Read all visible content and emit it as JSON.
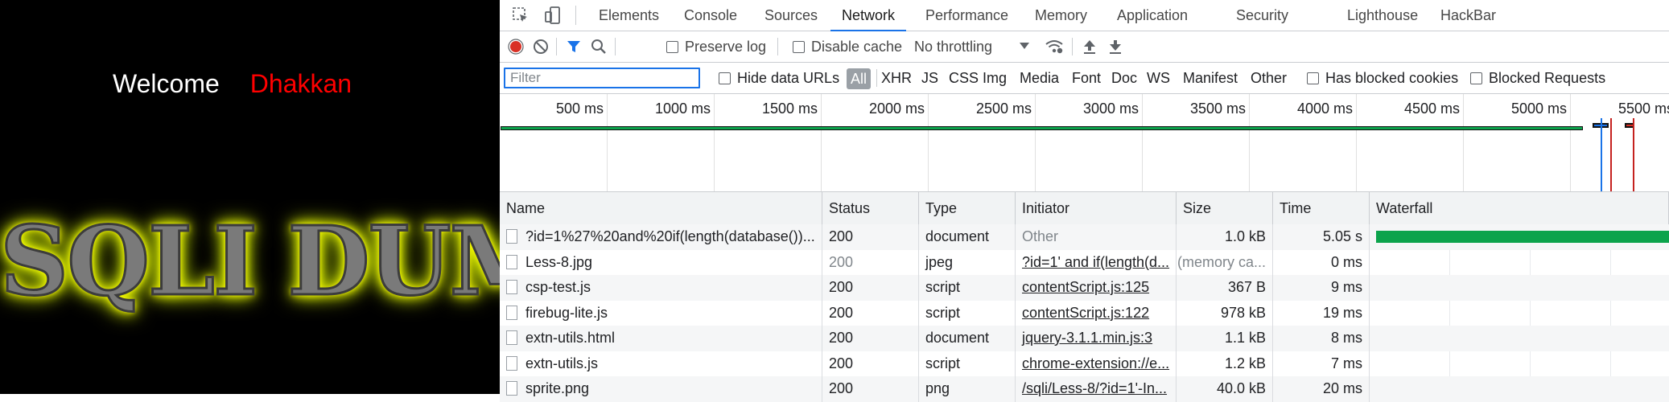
{
  "page": {
    "welcome_label": "Welcome",
    "user_name": "Dhakkan",
    "banner": "SQLI DUMB SERIES"
  },
  "devtools": {
    "tabs": [
      "Elements",
      "Console",
      "Sources",
      "Network",
      "Performance",
      "Memory",
      "Application",
      "Security",
      "Lighthouse",
      "HackBar"
    ],
    "active_tab": "Network",
    "toolbar": {
      "preserve_log": "Preserve log",
      "disable_cache": "Disable cache",
      "throttling": "No throttling"
    },
    "filterbar": {
      "filter_placeholder": "Filter",
      "hide_data_urls": "Hide data URLs",
      "types": [
        "All",
        "XHR",
        "JS",
        "CSS",
        "Img",
        "Media",
        "Font",
        "Doc",
        "WS",
        "Manifest",
        "Other"
      ],
      "has_blocked_cookies": "Has blocked cookies",
      "blocked_requests": "Blocked Requests"
    },
    "overview_ticks": [
      "500 ms",
      "1000 ms",
      "1500 ms",
      "2000 ms",
      "2500 ms",
      "3000 ms",
      "3500 ms",
      "4000 ms",
      "4500 ms",
      "5000 ms",
      "5500 ms"
    ],
    "columns": [
      "Name",
      "Status",
      "Type",
      "Initiator",
      "Size",
      "Time",
      "Waterfall"
    ],
    "rows": [
      {
        "name": "?id=1%27%20and%20if(length(database())...",
        "status": "200",
        "type": "document",
        "initiator": "Other",
        "size": "1.0 kB",
        "time": "5.05 s"
      },
      {
        "name": "Less-8.jpg",
        "status": "200",
        "type": "jpeg",
        "initiator": "?id=1' and if(length(d...",
        "size": "(memory ca...",
        "time": "0 ms"
      },
      {
        "name": "csp-test.js",
        "status": "200",
        "type": "script",
        "initiator": "contentScript.js:125",
        "size": "367 B",
        "time": "9 ms"
      },
      {
        "name": "firebug-lite.js",
        "status": "200",
        "type": "script",
        "initiator": "contentScript.js:122",
        "size": "978 kB",
        "time": "19 ms"
      },
      {
        "name": "extn-utils.html",
        "status": "200",
        "type": "document",
        "initiator": "jquery-3.1.1.min.js:3",
        "size": "1.1 kB",
        "time": "8 ms"
      },
      {
        "name": "extn-utils.js",
        "status": "200",
        "type": "script",
        "initiator": "chrome-extension://e...",
        "size": "1.2 kB",
        "time": "7 ms"
      },
      {
        "name": "sprite.png",
        "status": "200",
        "type": "png",
        "initiator": "/sqli/Less-8/?id=1'-In...",
        "size": "40.0 kB",
        "time": "20 ms"
      }
    ],
    "colors": {
      "accent": "#1a73e8",
      "record": "#d93025",
      "waterfall_bar": "#0ca34c"
    }
  }
}
